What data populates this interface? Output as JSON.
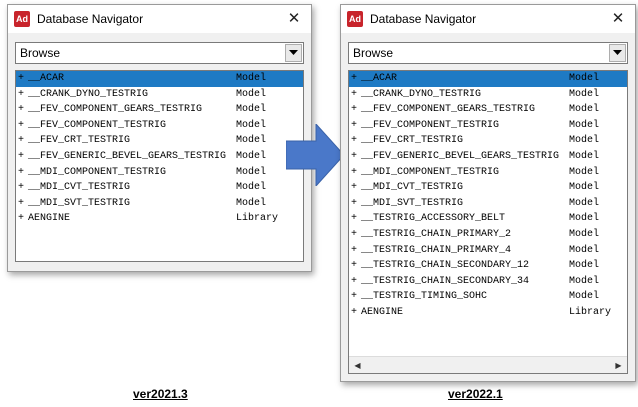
{
  "left_window": {
    "title": "Database Navigator",
    "icon_text": "Ad",
    "dropdown_value": "Browse",
    "rows": [
      {
        "prefix": "+",
        "name": "__ACAR",
        "type": "Model",
        "selected": true
      },
      {
        "prefix": "+",
        "name": "__CRANK_DYNO_TESTRIG",
        "type": "Model"
      },
      {
        "prefix": "+",
        "name": "__FEV_COMPONENT_GEARS_TESTRIG",
        "type": "Model"
      },
      {
        "prefix": "+",
        "name": "__FEV_COMPONENT_TESTRIG",
        "type": "Model"
      },
      {
        "prefix": "+",
        "name": "__FEV_CRT_TESTRIG",
        "type": "Model"
      },
      {
        "prefix": "+",
        "name": "__FEV_GENERIC_BEVEL_GEARS_TESTRIG",
        "type": "Model"
      },
      {
        "prefix": "+",
        "name": "__MDI_COMPONENT_TESTRIG",
        "type": "Model"
      },
      {
        "prefix": "+",
        "name": "__MDI_CVT_TESTRIG",
        "type": "Model"
      },
      {
        "prefix": "+",
        "name": "__MDI_SVT_TESTRIG",
        "type": "Model"
      },
      {
        "prefix": "+",
        "name": "AENGINE",
        "type": "Library"
      }
    ]
  },
  "right_window": {
    "title": "Database Navigator",
    "icon_text": "Ad",
    "dropdown_value": "Browse",
    "rows": [
      {
        "prefix": "+",
        "name": "__ACAR",
        "type": "Model",
        "selected": true
      },
      {
        "prefix": "+",
        "name": "__CRANK_DYNO_TESTRIG",
        "type": "Model"
      },
      {
        "prefix": "+",
        "name": "__FEV_COMPONENT_GEARS_TESTRIG",
        "type": "Model"
      },
      {
        "prefix": "+",
        "name": "__FEV_COMPONENT_TESTRIG",
        "type": "Model"
      },
      {
        "prefix": "+",
        "name": "__FEV_CRT_TESTRIG",
        "type": "Model"
      },
      {
        "prefix": "+",
        "name": "__FEV_GENERIC_BEVEL_GEARS_TESTRIG",
        "type": "Model"
      },
      {
        "prefix": "+",
        "name": "__MDI_COMPONENT_TESTRIG",
        "type": "Model"
      },
      {
        "prefix": "+",
        "name": "__MDI_CVT_TESTRIG",
        "type": "Model"
      },
      {
        "prefix": "+",
        "name": "__MDI_SVT_TESTRIG",
        "type": "Model"
      },
      {
        "prefix": "+",
        "name": "__TESTRIG_ACCESSORY_BELT",
        "type": "Model"
      },
      {
        "prefix": "+",
        "name": "__TESTRIG_CHAIN_PRIMARY_2",
        "type": "Model"
      },
      {
        "prefix": "+",
        "name": "__TESTRIG_CHAIN_PRIMARY_4",
        "type": "Model"
      },
      {
        "prefix": "+",
        "name": "__TESTRIG_CHAIN_SECONDARY_12",
        "type": "Model"
      },
      {
        "prefix": "+",
        "name": "__TESTRIG_CHAIN_SECONDARY_34",
        "type": "Model"
      },
      {
        "prefix": "+",
        "name": "__TESTRIG_TIMING_SOHC",
        "type": "Model"
      },
      {
        "prefix": "+",
        "name": "AENGINE",
        "type": "Library"
      }
    ]
  },
  "captions": {
    "left": "ver2021.3",
    "right": "ver2022.1"
  },
  "icons": {
    "close": "close-icon",
    "dropdown": "chevron-down-icon",
    "transition": "right-arrow-icon",
    "scroll_left": "scroll-left-icon",
    "scroll_right": "scroll-right-icon"
  },
  "colors": {
    "selection": "#1e7ac4",
    "arrow": "#4a78c9",
    "app_icon": "#c8242b"
  }
}
